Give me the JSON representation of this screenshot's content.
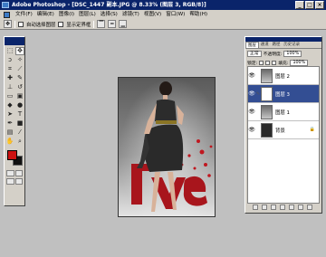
{
  "window": {
    "title": "Adobe Photoshop - [DSC_1447 副本.JPG @ 8.33% (图层 3, RGB/8)]",
    "minimize": "_",
    "maximize": "□",
    "close": "×"
  },
  "menu": {
    "items": [
      "文件(F)",
      "编辑(E)",
      "图像(I)",
      "图层(L)",
      "选择(S)",
      "滤镜(T)",
      "视图(V)",
      "窗口(W)",
      "帮助(H)"
    ]
  },
  "options": {
    "auto_select_label": "自动选择图层",
    "show_bounds_label": "显示定界框"
  },
  "layers_panel": {
    "tabs": [
      "图层",
      "通道",
      "路径",
      "历史记录"
    ],
    "blend_mode": "正常",
    "opacity_label": "不透明度:",
    "opacity_value": "100%",
    "lock_label": "锁定:",
    "fill_label": "填充:",
    "fill_value": "100%",
    "layers": [
      {
        "name": "图层 2",
        "visible": true,
        "selected": false,
        "thumb": "img"
      },
      {
        "name": "图层 3",
        "visible": true,
        "selected": true,
        "thumb": "red"
      },
      {
        "name": "图层 1",
        "visible": true,
        "selected": false,
        "thumb": "img"
      },
      {
        "name": "背景",
        "visible": true,
        "selected": false,
        "thumb": "bg",
        "locked": true
      }
    ]
  },
  "tools": [
    "move",
    "marquee",
    "lasso",
    "magic-wand",
    "crop",
    "slice",
    "healing",
    "brush",
    "stamp",
    "history-brush",
    "eraser",
    "gradient",
    "blur",
    "dodge",
    "path-select",
    "type",
    "pen",
    "shape",
    "notes",
    "eyedropper",
    "hand",
    "zoom"
  ],
  "colors": {
    "foreground": "#cc1111",
    "background": "#111111"
  }
}
